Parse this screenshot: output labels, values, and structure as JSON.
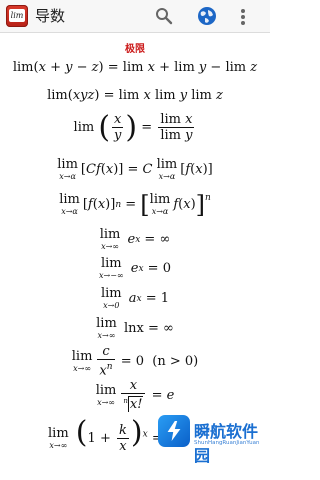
{
  "app": {
    "title": "导数",
    "icon_text": "lim"
  },
  "toolbar": {
    "search_icon": "search-icon",
    "globe_icon": "globe-icon",
    "overflow_icon": "more-vert-icon"
  },
  "content": {
    "section_title": "极限",
    "formulas": [
      "lim(x + y − z) = lim x + lim y − lim z",
      "lim(xyz) = lim x lim y lim z",
      "lim (x/y) = lim x / lim y",
      "lim_{x→a} [Cf(x)] = C lim_{x→a} [f(x)]",
      "lim_{x→a} [f(x)]^n = [lim_{x→a} f(x)]^n",
      "lim_{x→∞} e^x = ∞",
      "lim_{x→−∞} e^x = 0",
      "lim_{x→0} a^x = 1",
      "lim_{x→∞} lnx = ∞",
      "lim_{x→∞} c/x^n = 0 (n > 0)",
      "lim_{x→∞} x/ⁿ√(x!) = e",
      "lim_{x→∞} (1 + k/x)^x = e^k"
    ],
    "pieces": {
      "plus": "+",
      "minus": "−",
      "eq": "=",
      "lim": "lim",
      "C": "C",
      "f": "f",
      "x": "x",
      "y": "y",
      "z": "z",
      "e": "e",
      "a": "a",
      "n": "n",
      "c": "c",
      "k": "k",
      "one": "1",
      "zero": "0",
      "inf": "∞",
      "ln": "lnx",
      "sub_xa": "x→α",
      "sub_xinf": "x→∞",
      "sub_xneginf": "x→−∞",
      "sub_x0": "x→0",
      "cond": "(n > 0)",
      "xfact": "x!"
    }
  },
  "watermark": {
    "name": "瞬航软件园",
    "url_text": "ShunHangRuanJianYuan"
  }
}
